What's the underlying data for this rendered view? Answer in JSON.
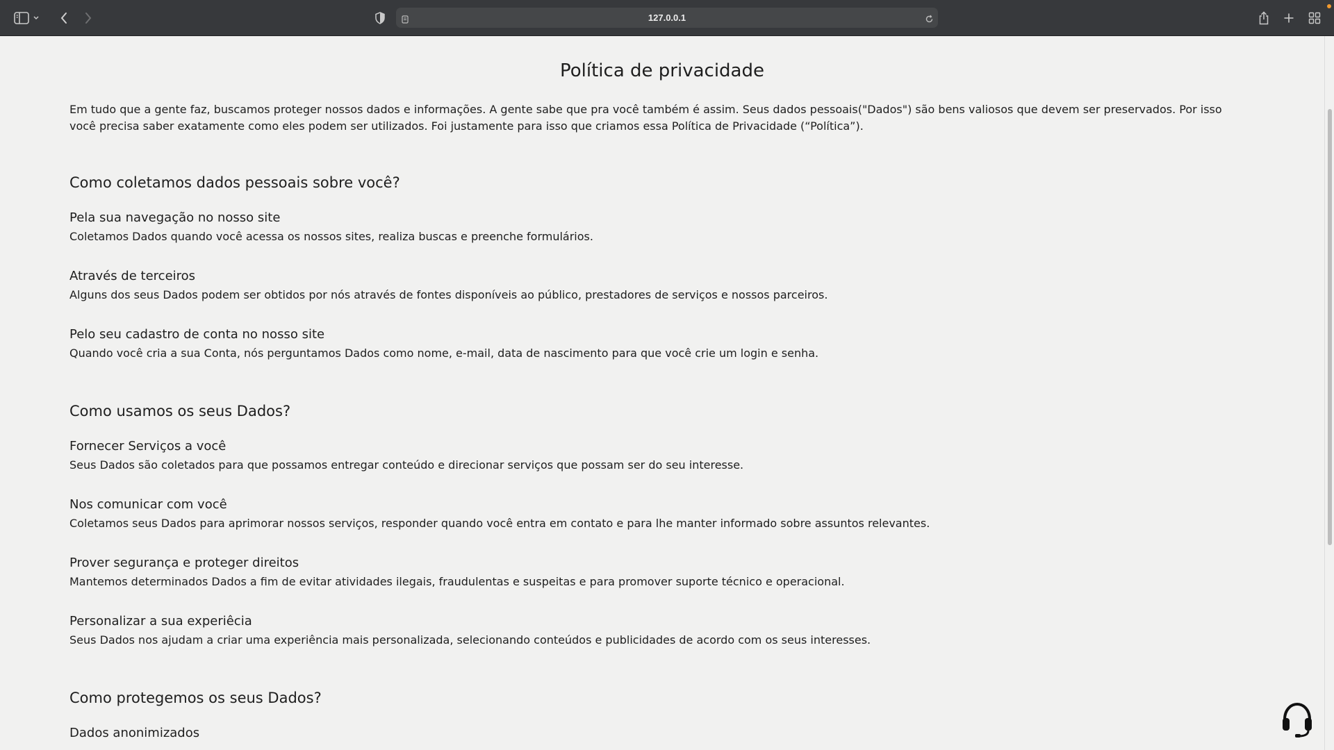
{
  "browser": {
    "url": "127.0.0.1",
    "colors": {
      "toolbar": "#37393c",
      "address_bar": "#454749",
      "notification_dot": "#f29a2e"
    },
    "icons": [
      "sidebar-icon",
      "chevron-down-icon",
      "back-icon",
      "forward-icon",
      "privacy-shield-icon",
      "page-icon",
      "reload-icon",
      "share-icon",
      "new-tab-icon",
      "tab-overview-icon"
    ]
  },
  "page": {
    "title": "Política de privacidade",
    "intro": "Em tudo que a gente faz, buscamos proteger nossos dados e informações. A gente sabe que pra você também é assim. Seus dados pessoais(\"Dados\") são bens valiosos que devem ser preservados. Por isso você precisa saber exatamente como eles podem ser utilizados. Foi justamente para isso que criamos essa Política de Privacidade (“Política”).",
    "sections": [
      {
        "title": "Como coletamos dados pessoais sobre você?",
        "items": [
          {
            "title": "Pela sua navegação no nosso site",
            "text": "Coletamos Dados quando você acessa os nossos sites, realiza buscas e preenche formulários."
          },
          {
            "title": "Através de terceiros",
            "text": "Alguns dos seus Dados podem ser obtidos por nós através de fontes disponíveis ao público, prestadores de serviços e nossos parceiros."
          },
          {
            "title": "Pelo seu cadastro de conta no nosso site",
            "text": "Quando você cria a sua Conta, nós perguntamos Dados como nome, e-mail, data de nascimento para que você crie um login e senha."
          }
        ]
      },
      {
        "title": "Como usamos os seus Dados?",
        "items": [
          {
            "title": "Fornecer Serviços a você",
            "text": "Seus Dados são coletados para que possamos entregar conteúdo e direcionar serviços que possam ser do seu interesse."
          },
          {
            "title": "Nos comunicar com você",
            "text": "Coletamos seus Dados para aprimorar nossos serviços, responder quando você entra em contato e para lhe manter informado sobre assuntos relevantes."
          },
          {
            "title": "Prover segurança e proteger direitos",
            "text": "Mantemos determinados Dados a fim de evitar atividades ilegais, fraudulentas e suspeitas e para promover suporte técnico e operacional."
          },
          {
            "title": "Personalizar a sua experiêcia",
            "text": "Seus Dados nos ajudam a criar uma experiência mais personalizada, selecionando conteúdos e publicidades de acordo com os seus interesses."
          }
        ]
      },
      {
        "title": "Como protegemos os seus Dados?",
        "items": [
          {
            "title": "Dados anonimizados",
            "text": ""
          }
        ]
      }
    ]
  },
  "widgets": {
    "support_icon": "headset-icon"
  }
}
